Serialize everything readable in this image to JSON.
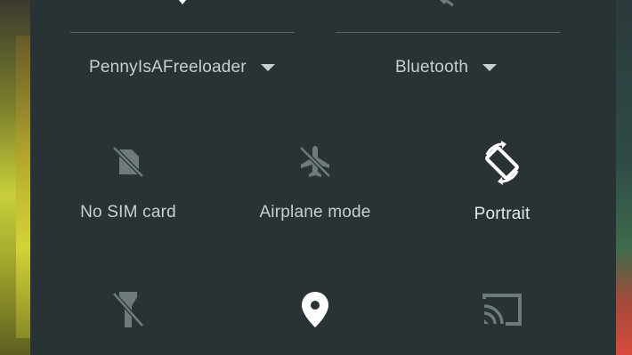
{
  "wifi": {
    "network_name": "PennyIsAFreeloader",
    "icon": "wifi-icon"
  },
  "bluetooth": {
    "label": "Bluetooth",
    "icon": "bluetooth-off-icon"
  },
  "tiles": [
    {
      "id": "sim",
      "label": "No SIM card",
      "icon": "no-sim-icon",
      "active": false
    },
    {
      "id": "airplane",
      "label": "Airplane mode",
      "icon": "airplane-off-icon",
      "active": false
    },
    {
      "id": "rotation",
      "label": "Portrait",
      "icon": "rotation-icon",
      "active": true
    },
    {
      "id": "flashlight",
      "label": "",
      "icon": "flashlight-off-icon",
      "active": false
    },
    {
      "id": "location",
      "label": "",
      "icon": "location-icon",
      "active": true
    },
    {
      "id": "cast",
      "label": "",
      "icon": "cast-icon",
      "active": false
    }
  ],
  "colors": {
    "panel_background": "#293235",
    "text": "#c9cfd1",
    "icon_active": "#ffffff",
    "icon_inactive": "#6f7a7c"
  }
}
